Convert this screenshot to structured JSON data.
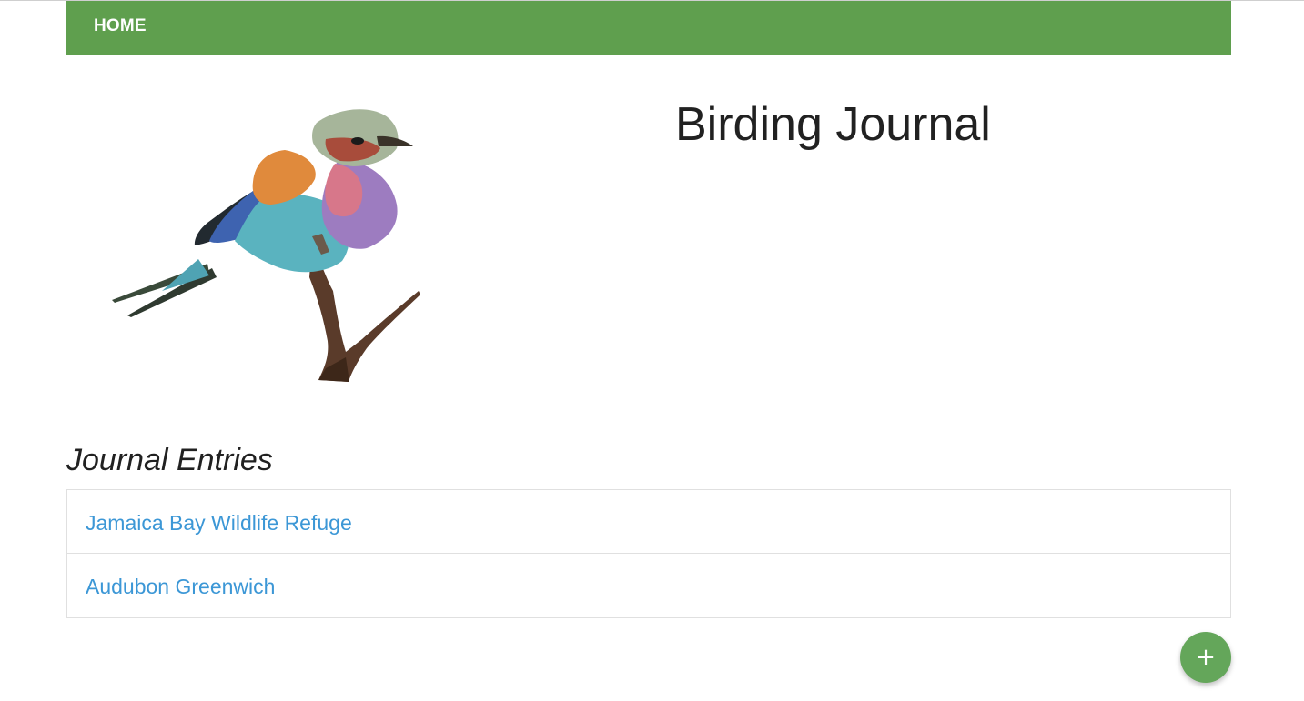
{
  "nav": {
    "home_label": "HOME"
  },
  "header": {
    "title": "Birding Journal",
    "image_icon": "bird-illustration-lilac-breasted-roller"
  },
  "journal": {
    "section_title": "Journal Entries",
    "entries": [
      {
        "label": "Jamaica Bay Wildlife Refuge"
      },
      {
        "label": "Audubon Greenwich"
      }
    ]
  },
  "fab": {
    "label": "+",
    "icon": "plus-icon"
  },
  "colors": {
    "navbar": "#5f9f4e",
    "link": "#3c97d6",
    "fab": "#64a65a",
    "text": "#212121",
    "border": "#e0e0e0"
  }
}
